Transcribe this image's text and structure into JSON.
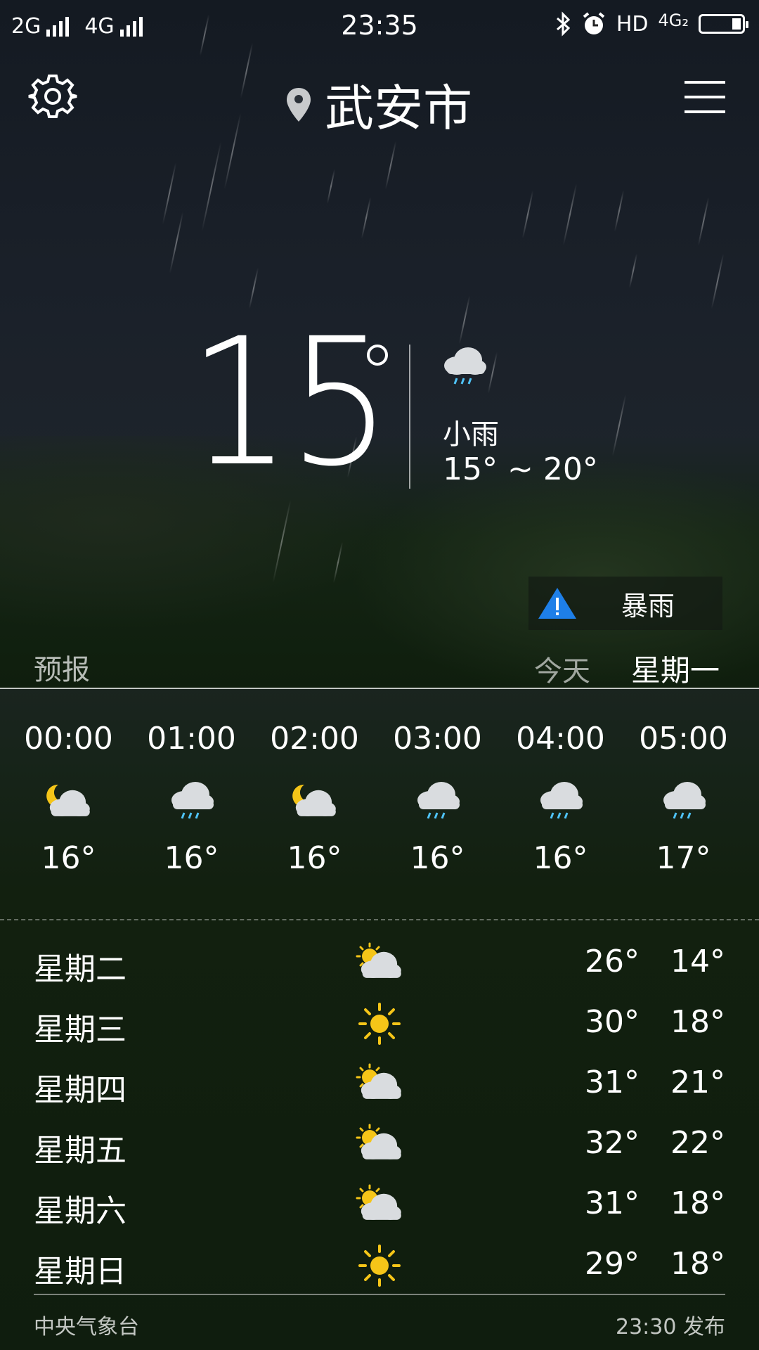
{
  "status_bar": {
    "network_1": "2G",
    "network_2": "4G",
    "time": "23:35",
    "hd": "HD",
    "net_right": "4G₂"
  },
  "header": {
    "city": "武安市"
  },
  "current": {
    "temp": "15",
    "condition": "小雨",
    "range": "15° ~ 20°",
    "icon": "cloud-rain-icon"
  },
  "alert": {
    "label": "暴雨",
    "color": "#1e7fe8"
  },
  "forecast": {
    "label": "预报",
    "today": "今天",
    "day": "星期一"
  },
  "hourly": [
    {
      "time": "00:00",
      "icon": "moon-cloud-icon",
      "temp": "16°"
    },
    {
      "time": "01:00",
      "icon": "cloud-rain-icon",
      "temp": "16°"
    },
    {
      "time": "02:00",
      "icon": "moon-cloud-icon",
      "temp": "16°"
    },
    {
      "time": "03:00",
      "icon": "cloud-rain-icon",
      "temp": "16°"
    },
    {
      "time": "04:00",
      "icon": "cloud-rain-icon",
      "temp": "16°"
    },
    {
      "time": "05:00",
      "icon": "cloud-rain-icon",
      "temp": "17°"
    }
  ],
  "daily": [
    {
      "day": "星期二",
      "icon": "sun-cloud-icon",
      "high": "26°",
      "low": "14°"
    },
    {
      "day": "星期三",
      "icon": "sun-icon",
      "high": "30°",
      "low": "18°"
    },
    {
      "day": "星期四",
      "icon": "sun-cloud-icon",
      "high": "31°",
      "low": "21°"
    },
    {
      "day": "星期五",
      "icon": "sun-cloud-icon",
      "high": "32°",
      "low": "22°"
    },
    {
      "day": "星期六",
      "icon": "sun-cloud-icon",
      "high": "31°",
      "low": "18°"
    },
    {
      "day": "星期日",
      "icon": "sun-icon",
      "high": "29°",
      "low": "18°"
    }
  ],
  "footer": {
    "source": "中央气象台",
    "published": "23:30 发布"
  },
  "colors": {
    "sun": "#f5c518",
    "rain": "#4fc3f7",
    "cloud": "#d9dcdf"
  }
}
